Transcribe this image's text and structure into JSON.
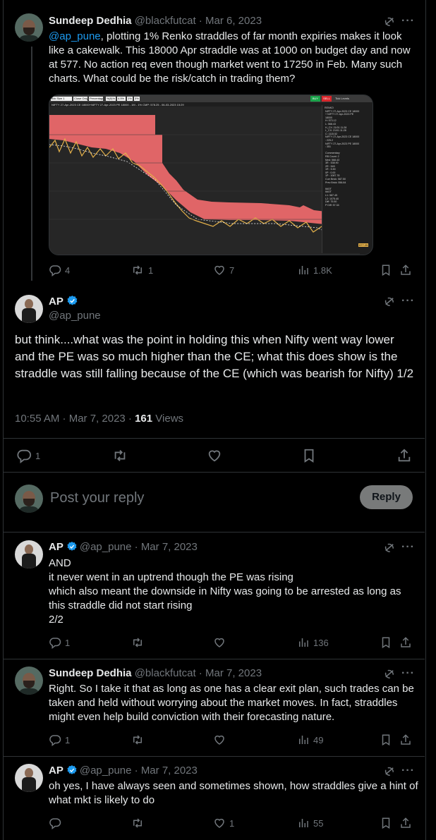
{
  "colors": {
    "background": "#000000",
    "text": "#e7e9ea",
    "muted": "#71767b",
    "link": "#1d9bf0",
    "verified": "#1d9bf0",
    "border": "#2f3336"
  },
  "tweet1": {
    "name": "Sundeep Dedhia",
    "handle": "@blackfutcat",
    "date": "Mar 6, 2023",
    "mention": "@ap_pune",
    "body": ", plotting 1% Renko straddles of far month expiries makes it look like a cakewalk. This 18000 Apr straddle was at 1000 on budget day and now at 577. No action req even though market went to 17250 in Feb. Many such charts. What could be the risk/catch in trading them?",
    "stats": {
      "replies": "4",
      "reposts": "1",
      "likes": "7",
      "views": "1.8K"
    },
    "chart": {
      "toolbar": [
        "ock Size 1",
        "Close Only",
        "Percentage",
        "%(5)%",
        "4.5%",
        "1%",
        "3%"
      ],
      "buy": "BUY",
      "sell": "SELL",
      "tick": "Tick Levels",
      "title": "NIFTY 27-Apr-2023 CE 18000+NIFTY 27-Apr-2023 PE 18000 - 1M - 1% CMP: 578.25 - 06-03-2023 15:29",
      "panel": "RENKO\n NIFTY 27-Apr-2023 CE 18000\n + NIFTY 27-Apr-2023 PE\n 18000\n H: 573.12\n L: 568.43\n H_CX: 21/01 11:28\n L_CX: 21/01 11:28\n C: 1115.52\n NIFTY 27-Apr-2023 CE 18000\n : 225.2\n NIFTY 27-Apr-2023 PE 18000\n : 351\n\n Commentary\n RB Count: 2\n Med: 568.43\n 3R : 538.90\n 2R : 549\n 1R : 5.50\n 0P : 0.00\n 1P : 1087.78\n Curr Brick: 587.50\n Prev Brick: 556.84\n\n IMOT\n IMOT\n L1: 587.45\n L2: 1075.40\n Diff: 75.50\n P Diff: 57.34",
      "yticks": [
        "1101",
        "1040",
        "969",
        "902",
        "846",
        "787",
        "719",
        "660",
        "594"
      ],
      "last": "577.25"
    }
  },
  "tweet2": {
    "name": "AP",
    "handle": "@ap_pune",
    "body": "but think....what was the point in holding this when Nifty went way lower and the PE was so much higher than the CE; what this does show is the straddle was still falling because of the CE (which was bearish for Nifty) 1/2",
    "time": "10:55 AM · Mar 7, 2023 · ",
    "views_count": "161",
    "views_label": " Views",
    "stats": {
      "replies": "1"
    }
  },
  "reply_box": {
    "placeholder": "Post your reply",
    "button": "Reply"
  },
  "tweet3": {
    "name": "AP",
    "handle": "@ap_pune",
    "date": "Mar 7, 2023",
    "lines": [
      "AND",
      "it never went in an uptrend though the PE was rising",
      "which also meant the downside in Nifty was going to be arrested as long as",
      "this straddle did not start rising",
      "2/2"
    ],
    "stats": {
      "replies": "1",
      "views": "136"
    }
  },
  "tweet4": {
    "name": "Sundeep Dedhia",
    "handle": "@blackfutcat",
    "date": "Mar 7, 2023",
    "body": "Right. So I take it that as long as one has a clear exit plan, such trades can be taken and held without worrying about the market moves. In fact, straddles might even help build conviction with their forecasting nature.",
    "stats": {
      "replies": "1",
      "views": "49"
    }
  },
  "tweet5": {
    "name": "AP",
    "handle": "@ap_pune",
    "date": "Mar 7, 2023",
    "body": "oh yes, I have always seen and sometimes shown, how straddles give a hint of what mkt is likely to do",
    "stats": {
      "likes": "1",
      "views": "55"
    }
  },
  "sep": " · "
}
